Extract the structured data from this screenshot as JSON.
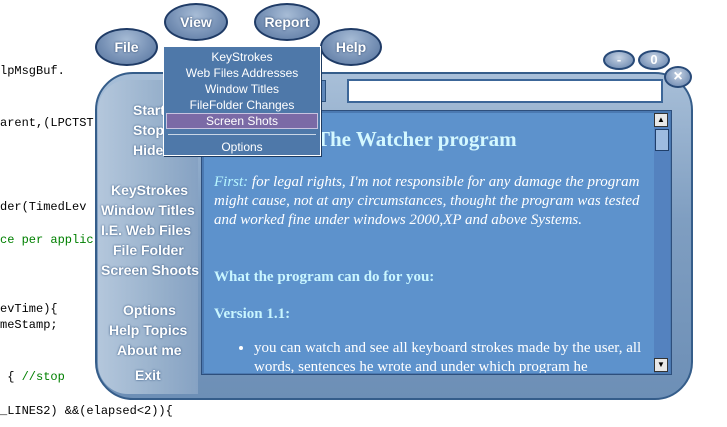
{
  "background_code": {
    "lines": [
      {
        "text": "lpMsgBuf.",
        "comment": ""
      },
      {
        "text": "arent,(LPCTST",
        "comment": ""
      },
      {
        "text": "der(TimedLev",
        "comment": ""
      },
      {
        "text": "",
        "comment": "ce per applic"
      },
      {
        "text": "evTime){",
        "comment": ""
      },
      {
        "text": "meStamp;",
        "comment": ""
      },
      {
        "text": " { ",
        "comment": "//stop"
      },
      {
        "text": "_LINES2) &&(elapsed<2)){",
        "comment": ""
      }
    ]
  },
  "top_menu": {
    "file": "File",
    "view": "View",
    "report": "Report",
    "help": "Help"
  },
  "window_controls": {
    "minimize": "-",
    "restore": "0",
    "close": "×"
  },
  "view_menu": {
    "items": [
      "KeyStrokes",
      "Web Files Addresses",
      "Window Titles",
      "FileFolder Changes",
      "Screen Shots"
    ],
    "selected_index": 4,
    "options": "Options"
  },
  "sidebar": {
    "top_items": [
      "Start",
      "Stop",
      "Hide"
    ],
    "log_items": [
      "KeyStrokes",
      "Window Titles",
      "I.E. Web Files",
      "File Folder",
      "Screen Shoots"
    ],
    "bottom_items": [
      "Options",
      "Help Topics",
      "About me"
    ],
    "exit": "Exit"
  },
  "address_bar": {
    "value": ""
  },
  "document": {
    "title": "The Watcher program",
    "first_label": "First:",
    "first_text": " for legal rights, I'm not responsible for any damage the program might cause, not at any circumstances, thought the program was tested and worked fine under windows 2000,XP and above Systems.",
    "section1": "What the program can do for you:",
    "version": "Version 1.1:",
    "bullet1": "you can watch and see all keyboard strokes made by the user, all words, sentences he wrote and under which program he"
  },
  "colors": {
    "accent": "#5d92cc",
    "menu_bg": "#4e78a9",
    "selected": "#7b6aa6"
  }
}
